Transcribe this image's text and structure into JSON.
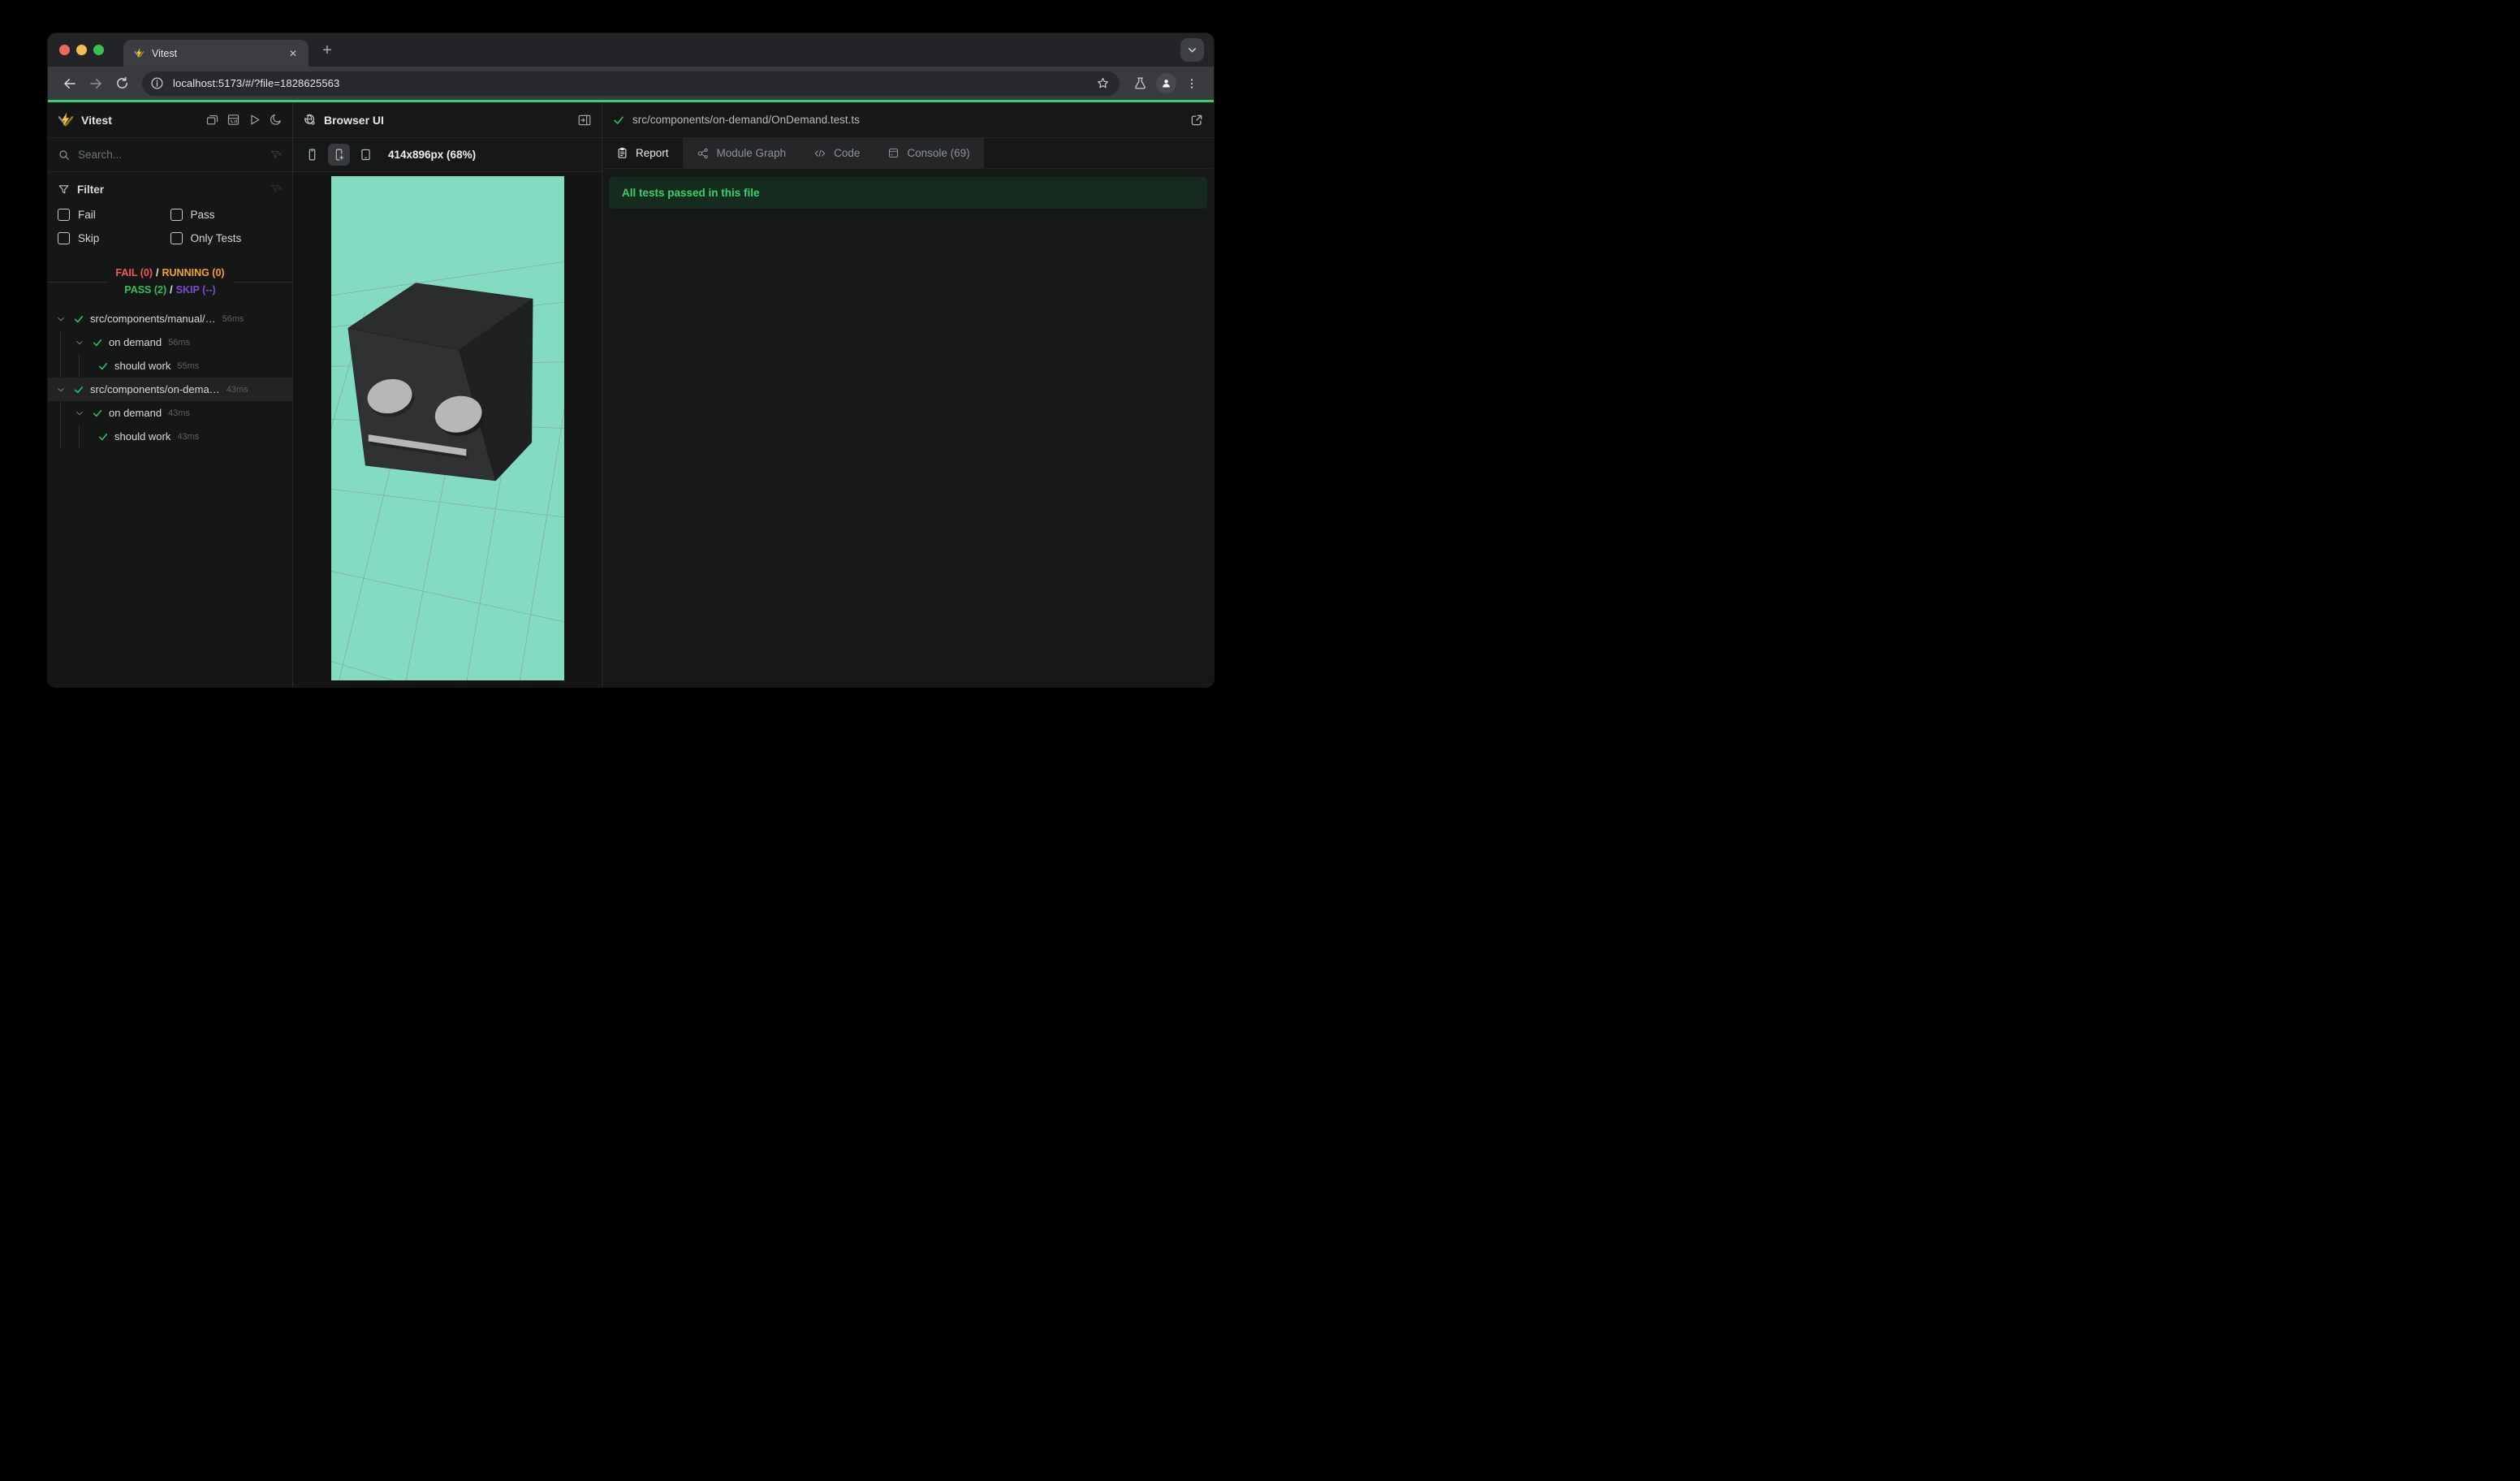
{
  "browser": {
    "tab_title": "Vitest",
    "url": "localhost:5173/#/?file=1828625563"
  },
  "sidebar": {
    "app_title": "Vitest",
    "search_placeholder": "Search...",
    "filter": {
      "title": "Filter",
      "options": [
        {
          "label": "Fail",
          "checked": false
        },
        {
          "label": "Pass",
          "checked": false
        },
        {
          "label": "Skip",
          "checked": false
        },
        {
          "label": "Only Tests",
          "checked": false
        }
      ]
    },
    "stats": {
      "line1": [
        {
          "text": "FAIL (0)",
          "color": "#f2594f"
        },
        {
          "text": "/",
          "color": "#e8eaeb"
        },
        {
          "text": "RUNNING (0)",
          "color": "#f3a22b"
        }
      ],
      "line2": [
        {
          "text": "PASS (2)",
          "color": "#2fc05c"
        },
        {
          "text": "/",
          "color": "#e8eaeb"
        },
        {
          "text": "SKIP (--)",
          "color": "#7e4ccc"
        }
      ]
    },
    "tree": [
      {
        "label": "src/components/manual/…",
        "duration": "56ms",
        "level": 0,
        "expandable": true,
        "selected": false
      },
      {
        "label": "on demand",
        "duration": "56ms",
        "level": 1,
        "expandable": true,
        "selected": false
      },
      {
        "label": "should work",
        "duration": "55ms",
        "level": 2,
        "expandable": false,
        "selected": false
      },
      {
        "label": "src/components/on-dema…",
        "duration": "43ms",
        "level": 0,
        "expandable": true,
        "selected": true
      },
      {
        "label": "on demand",
        "duration": "43ms",
        "level": 1,
        "expandable": true,
        "selected": false
      },
      {
        "label": "should work",
        "duration": "43ms",
        "level": 2,
        "expandable": false,
        "selected": false
      }
    ]
  },
  "preview": {
    "title": "Browser UI",
    "viewport_label": "414x896px (68%)"
  },
  "results": {
    "file": "src/components/on-demand/OnDemand.test.ts",
    "tabs": [
      {
        "label": "Report",
        "active": true
      },
      {
        "label": "Module Graph",
        "active": false
      },
      {
        "label": "Code",
        "active": false
      },
      {
        "label": "Console (69)",
        "active": false
      }
    ],
    "banner": "All tests passed in this file"
  },
  "scene": {
    "background": "#83dcc1",
    "grid_line": "#8a8f8c",
    "cube_top": "#2b2c2c",
    "cube_front": "#303132",
    "cube_side": "#1f2021",
    "feature_color": "#b7b7b7"
  }
}
